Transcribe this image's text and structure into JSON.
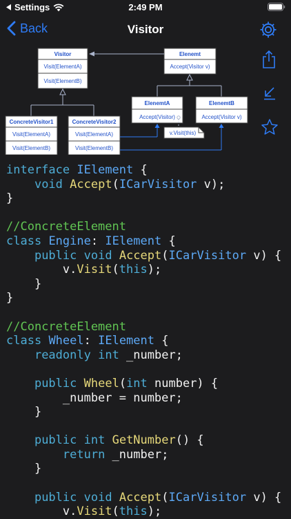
{
  "status_bar": {
    "back_app": "Settings",
    "time": "2:49 PM"
  },
  "nav": {
    "back_label": "Back",
    "title": "Visitor"
  },
  "colors": {
    "accent": "#2f7cf6",
    "background": "#1c1c1e",
    "keyword": "#4eadd6",
    "type": "#5da9f6",
    "function": "#e6d87a",
    "comment": "#61c553"
  },
  "icons": [
    "chevron-left-icon",
    "wifi-icon",
    "battery-icon",
    "gear-icon",
    "share-icon",
    "arrow-down-left-icon",
    "star-icon"
  ],
  "diagram": {
    "visitor": {
      "name": "Visitor",
      "methods": [
        "Visit(ElementA)",
        "Visit(ElementB)"
      ]
    },
    "element": {
      "name": "Elenemt",
      "methods": [
        "Accept(Visitor v)"
      ]
    },
    "concrete_visitor_1": {
      "name": "ConcreteVisitor1",
      "methods": [
        "Visit(ElementA)",
        "Visit(ElementB)"
      ]
    },
    "concrete_visitor_2": {
      "name": "ConcreteVisitor2",
      "methods": [
        "Visit(ElementA)",
        "Visit(ElementB)"
      ]
    },
    "element_a": {
      "name": "ElenemtA",
      "methods": [
        "Accept(Visitor)"
      ]
    },
    "element_b": {
      "name": "ElenemtB",
      "methods": [
        "Accept(Visitor v)"
      ]
    },
    "note": "v.Visit(this)"
  },
  "code_lines": [
    [
      [
        "kw",
        "interface"
      ],
      [
        "pn",
        " "
      ],
      [
        "ty",
        "IElement"
      ],
      [
        "pn",
        " {"
      ]
    ],
    [
      [
        "pn",
        "    "
      ],
      [
        "kw",
        "void"
      ],
      [
        "pn",
        " "
      ],
      [
        "fn",
        "Accept"
      ],
      [
        "pn",
        "("
      ],
      [
        "ty",
        "ICarVisitor"
      ],
      [
        "pn",
        " v);"
      ]
    ],
    [
      [
        "pn",
        "}"
      ]
    ],
    [],
    [
      [
        "cm",
        "//ConcreteElement"
      ]
    ],
    [
      [
        "kw",
        "class"
      ],
      [
        "pn",
        " "
      ],
      [
        "ty",
        "Engine"
      ],
      [
        "pn",
        ": "
      ],
      [
        "ty",
        "IElement"
      ],
      [
        "pn",
        " {"
      ]
    ],
    [
      [
        "pn",
        "    "
      ],
      [
        "kw",
        "public"
      ],
      [
        "pn",
        " "
      ],
      [
        "kw",
        "void"
      ],
      [
        "pn",
        " "
      ],
      [
        "fn",
        "Accept"
      ],
      [
        "pn",
        "("
      ],
      [
        "ty",
        "ICarVisitor"
      ],
      [
        "pn",
        " v) {"
      ]
    ],
    [
      [
        "pn",
        "        v."
      ],
      [
        "fn",
        "Visit"
      ],
      [
        "pn",
        "("
      ],
      [
        "kw",
        "this"
      ],
      [
        "pn",
        ");"
      ]
    ],
    [
      [
        "pn",
        "    }"
      ]
    ],
    [
      [
        "pn",
        "}"
      ]
    ],
    [],
    [
      [
        "cm",
        "//ConcreteElement"
      ]
    ],
    [
      [
        "kw",
        "class"
      ],
      [
        "pn",
        " "
      ],
      [
        "ty",
        "Wheel"
      ],
      [
        "pn",
        ": "
      ],
      [
        "ty",
        "IElement"
      ],
      [
        "pn",
        " {"
      ]
    ],
    [
      [
        "pn",
        "    "
      ],
      [
        "kw",
        "readonly"
      ],
      [
        "pn",
        " "
      ],
      [
        "kw",
        "int"
      ],
      [
        "pn",
        " _number;"
      ]
    ],
    [],
    [
      [
        "pn",
        "    "
      ],
      [
        "kw",
        "public"
      ],
      [
        "pn",
        " "
      ],
      [
        "fn",
        "Wheel"
      ],
      [
        "pn",
        "("
      ],
      [
        "kw",
        "int"
      ],
      [
        "pn",
        " number) {"
      ]
    ],
    [
      [
        "pn",
        "        _number = number;"
      ]
    ],
    [
      [
        "pn",
        "    }"
      ]
    ],
    [],
    [
      [
        "pn",
        "    "
      ],
      [
        "kw",
        "public"
      ],
      [
        "pn",
        " "
      ],
      [
        "kw",
        "int"
      ],
      [
        "pn",
        " "
      ],
      [
        "fn",
        "GetNumber"
      ],
      [
        "pn",
        "() {"
      ]
    ],
    [
      [
        "pn",
        "        "
      ],
      [
        "kw",
        "return"
      ],
      [
        "pn",
        " _number;"
      ]
    ],
    [
      [
        "pn",
        "    }"
      ]
    ],
    [],
    [
      [
        "pn",
        "    "
      ],
      [
        "kw",
        "public"
      ],
      [
        "pn",
        " "
      ],
      [
        "kw",
        "void"
      ],
      [
        "pn",
        " "
      ],
      [
        "fn",
        "Accept"
      ],
      [
        "pn",
        "("
      ],
      [
        "ty",
        "ICarVisitor"
      ],
      [
        "pn",
        " v) {"
      ]
    ],
    [
      [
        "pn",
        "        v."
      ],
      [
        "fn",
        "Visit"
      ],
      [
        "pn",
        "("
      ],
      [
        "kw",
        "this"
      ],
      [
        "pn",
        ");"
      ]
    ]
  ]
}
